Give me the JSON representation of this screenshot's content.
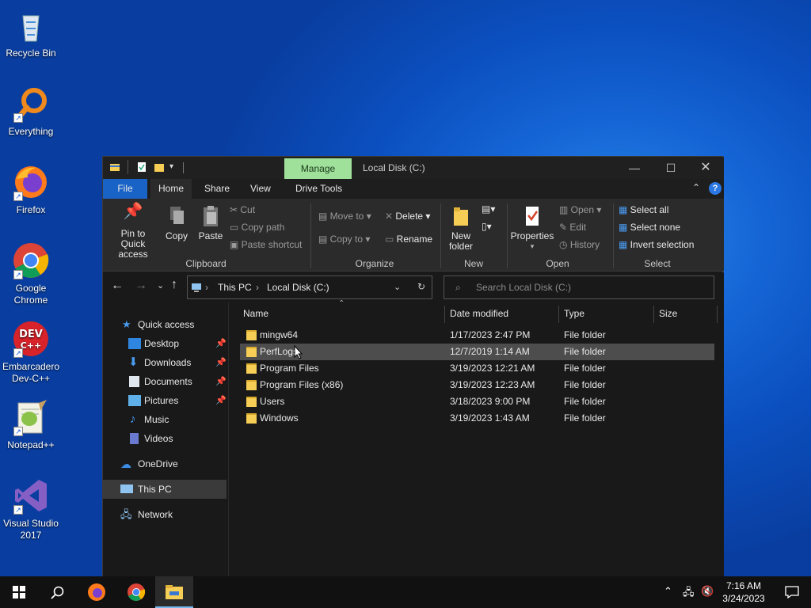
{
  "desktop": {
    "icons": [
      {
        "label": "Recycle Bin"
      },
      {
        "label": "Everything"
      },
      {
        "label": "Firefox"
      },
      {
        "label": "Google Chrome"
      },
      {
        "label": "Embarcadero Dev-C++"
      },
      {
        "label": "Notepad++"
      },
      {
        "label": "Visual Studio 2017"
      }
    ]
  },
  "window": {
    "context_tab": "Manage",
    "title": "Local Disk (C:)",
    "tabs": {
      "file": "File",
      "home": "Home",
      "share": "Share",
      "view": "View",
      "drive_tools": "Drive Tools"
    },
    "ribbon": {
      "clipboard": {
        "pin": "Pin to Quick access",
        "copy": "Copy",
        "paste": "Paste",
        "cut": "Cut",
        "copy_path": "Copy path",
        "paste_shortcut": "Paste shortcut",
        "group": "Clipboard"
      },
      "organize": {
        "move_to": "Move to",
        "copy_to": "Copy to",
        "delete": "Delete",
        "rename": "Rename",
        "group": "Organize"
      },
      "new": {
        "new_folder": "New folder",
        "group": "New"
      },
      "open": {
        "properties": "Properties",
        "open": "Open",
        "edit": "Edit",
        "history": "History",
        "group": "Open"
      },
      "select": {
        "select_all": "Select all",
        "select_none": "Select none",
        "invert": "Invert selection",
        "group": "Select"
      }
    },
    "address": {
      "crumbs": [
        "This PC",
        "Local Disk (C:)"
      ],
      "search_placeholder": "Search Local Disk (C:)"
    },
    "nav": {
      "quick_access": "Quick access",
      "desktop": "Desktop",
      "downloads": "Downloads",
      "documents": "Documents",
      "pictures": "Pictures",
      "music": "Music",
      "videos": "Videos",
      "onedrive": "OneDrive",
      "this_pc": "This PC",
      "network": "Network"
    },
    "columns": {
      "name": "Name",
      "date": "Date modified",
      "type": "Type",
      "size": "Size"
    },
    "files": [
      {
        "name": "mingw64",
        "date": "1/17/2023 2:47 PM",
        "type": "File folder"
      },
      {
        "name": "PerfLogs",
        "date": "12/7/2019 1:14 AM",
        "type": "File folder"
      },
      {
        "name": "Program Files",
        "date": "3/19/2023 12:21 AM",
        "type": "File folder"
      },
      {
        "name": "Program Files (x86)",
        "date": "3/19/2023 12:23 AM",
        "type": "File folder"
      },
      {
        "name": "Users",
        "date": "3/18/2023 9:00 PM",
        "type": "File folder"
      },
      {
        "name": "Windows",
        "date": "3/19/2023 1:43 AM",
        "type": "File folder"
      }
    ]
  },
  "taskbar": {
    "time": "7:16 AM",
    "date": "3/24/2023"
  },
  "colors": {
    "accent": "#1a63c6",
    "manage_tab": "#9fe09a",
    "folder": "#f6cd55"
  }
}
